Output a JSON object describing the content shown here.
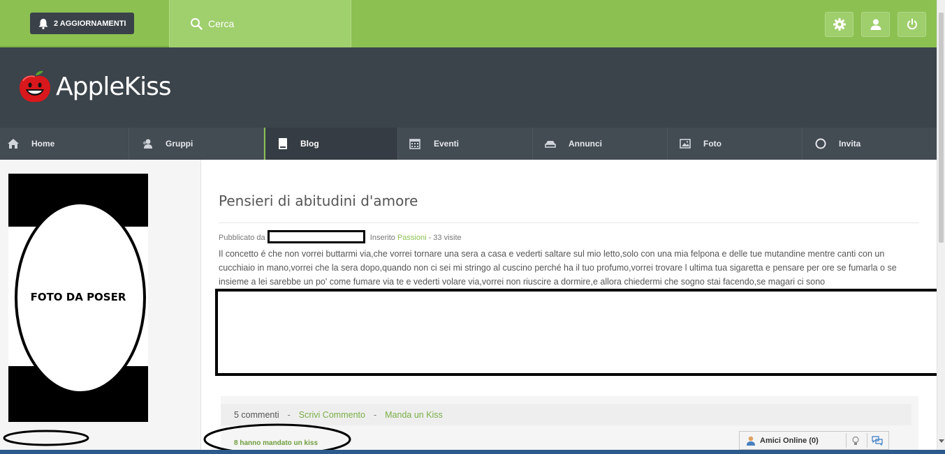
{
  "topbar": {
    "updates_label": "2 AGGIORNAMENTI",
    "search_placeholder": "Cerca",
    "icons": [
      "gear-icon",
      "user-icon",
      "power-icon"
    ]
  },
  "header": {
    "logo_text": "AppleKiss"
  },
  "nav": {
    "items": [
      {
        "label": "Home",
        "icon": "home-icon"
      },
      {
        "label": "Gruppi",
        "icon": "groups-icon"
      },
      {
        "label": "Blog",
        "icon": "blog-icon",
        "active": true
      },
      {
        "label": "Eventi",
        "icon": "calendar-icon"
      },
      {
        "label": "Annunci",
        "icon": "ads-icon"
      },
      {
        "label": "Foto",
        "icon": "photo-icon"
      },
      {
        "label": "Invita",
        "icon": "circle-icon"
      }
    ]
  },
  "sidebar": {
    "photo_caption": "FOTO DA POSER"
  },
  "post": {
    "title": "Pensieri di abitudini d'amore",
    "meta_prefix": "Pubblicato da",
    "meta_inserted": "Inserito",
    "category": "Passioni",
    "views": "- 33 visite",
    "body": "Il concetto é che non vorrei buttarmi via,che vorrei tornare una sera a casa e vederti saltare sul mio letto,solo con una mia felpona e delle tue mutandine mentre canti con un cucchiaio in mano,vorrei che la sera dopo,quando non ci sei mi stringo al cuscino perché ha il tuo profumo,vorrei trovare l ultima tua sigaretta e pensare per ore se fumarla o se insieme a lei sarebbe un po' come fumare via te e vederti volare via,vorrei non riuscire a dormire,e allora chiedermi che sogno stai facendo,se magari ci sono"
  },
  "comments": {
    "count_label": "5 commenti",
    "separator": "-",
    "write_comment": "Scrivi Commento",
    "send_kiss": "Manda un Kiss",
    "kiss_count": "8 hanno mandato un kiss"
  },
  "friends": {
    "label": "Amici Online (0)"
  },
  "colors": {
    "accent": "#8cc152",
    "header": "#3b434b",
    "nav": "#434b53"
  }
}
